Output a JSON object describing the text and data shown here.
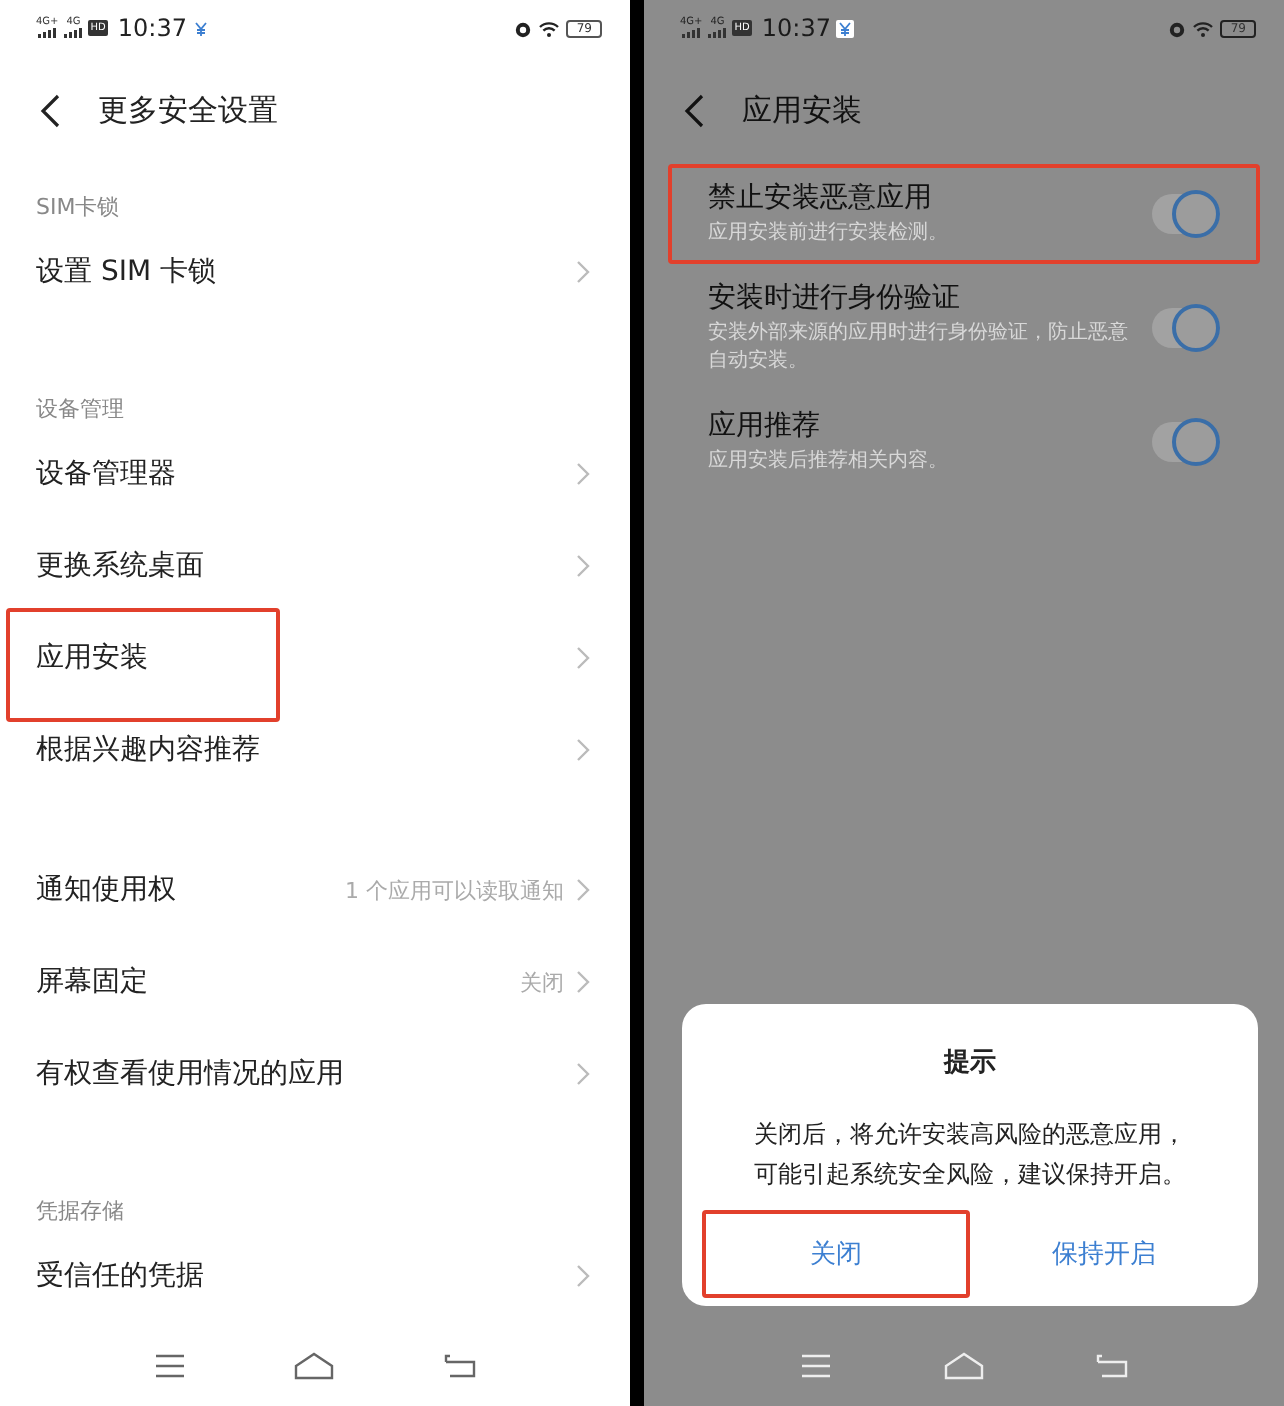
{
  "left_screen": {
    "status_bar": {
      "network_labels": [
        "4G+",
        "4G"
      ],
      "hd": "HD",
      "time": "10:37",
      "battery": "79"
    },
    "header": {
      "title": "更多安全设置"
    },
    "sections": [
      {
        "title": "SIM卡锁",
        "items": [
          {
            "label": "设置 SIM 卡锁",
            "highlighted": false
          }
        ]
      },
      {
        "title": "设备管理",
        "items": [
          {
            "label": "设备管理器",
            "highlighted": false
          },
          {
            "label": "更换系统桌面",
            "highlighted": false
          },
          {
            "label": "应用安装",
            "highlighted": true
          },
          {
            "label": "根据兴趣内容推荐",
            "highlighted": false
          }
        ]
      },
      {
        "items": [
          {
            "label": "通知使用权",
            "value": "1 个应用可以读取通知",
            "highlighted": false
          },
          {
            "label": "屏幕固定",
            "value": "关闭",
            "highlighted": false
          },
          {
            "label": "有权查看使用情况的应用",
            "highlighted": false
          }
        ]
      },
      {
        "title": "凭据存储",
        "items": [
          {
            "label": "受信任的凭据",
            "highlighted": false
          }
        ]
      }
    ]
  },
  "right_screen": {
    "status_bar": {
      "network_labels": [
        "4G+",
        "4G"
      ],
      "hd": "HD",
      "time": "10:37",
      "battery": "79"
    },
    "header": {
      "title": "应用安装"
    },
    "toggles": [
      {
        "title": "禁止安装恶意应用",
        "description": "应用安装前进行安装检测。",
        "on": true,
        "highlighted": true
      },
      {
        "title": "安装时进行身份验证",
        "description": "安装外部来源的应用时进行身份验证，防止恶意自动安装。",
        "on": true,
        "highlighted": false
      },
      {
        "title": "应用推荐",
        "description": "应用安装后推荐相关内容。",
        "on": true,
        "highlighted": false
      }
    ],
    "dialog": {
      "title": "提示",
      "message_lines": [
        "关闭后，将允许安装高风险的恶意应用，",
        "可能引起系统安全风险，建议保持开启。"
      ],
      "buttons": [
        {
          "label": "关闭",
          "highlighted": true
        },
        {
          "label": "保持开启",
          "highlighted": false
        }
      ]
    }
  }
}
